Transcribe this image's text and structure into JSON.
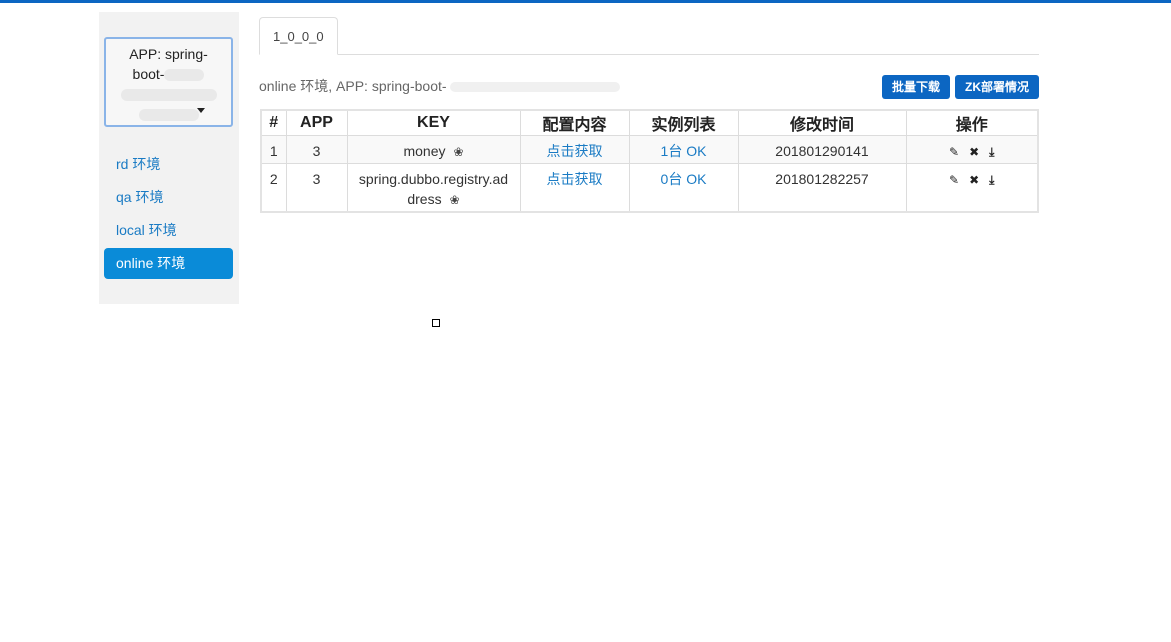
{
  "sidebar": {
    "app_select": {
      "label_line1": "APP: spring-",
      "label_line2": "boot-",
      "label_line3": "",
      "label_line4": "",
      "caret_icon": "caret-down-icon"
    },
    "env_items": [
      {
        "label": "rd 环境",
        "active": false
      },
      {
        "label": "qa 环境",
        "active": false
      },
      {
        "label": "local 环境",
        "active": false
      },
      {
        "label": "online 环境",
        "active": true
      }
    ]
  },
  "tabs": [
    {
      "label": "1_0_0_0"
    }
  ],
  "info_line": {
    "text": "online 环境, APP: spring-boot-"
  },
  "actions": {
    "batch_download": "批量下载",
    "zk_deploy": "ZK部署情况"
  },
  "table": {
    "headers": [
      "#",
      "APP",
      "KEY",
      "配置内容",
      "实例列表",
      "修改时间",
      "操作"
    ],
    "rows": [
      {
        "index": "1",
        "app": "3",
        "key": "money",
        "content": "点击获取",
        "instances": "1台 OK",
        "modified": "201801290141"
      },
      {
        "index": "2",
        "app": "3",
        "key": "spring.dubbo.registry.ad",
        "key_line2": "dress",
        "content": "点击获取",
        "instances": "0台 OK",
        "modified": "201801282257"
      }
    ],
    "op_icons": [
      "edit-icon",
      "delete-icon",
      "download-icon"
    ]
  },
  "colors": {
    "accent": "#0c66c2",
    "active_env": "#0a8bd8",
    "link": "#1a7bc4"
  }
}
